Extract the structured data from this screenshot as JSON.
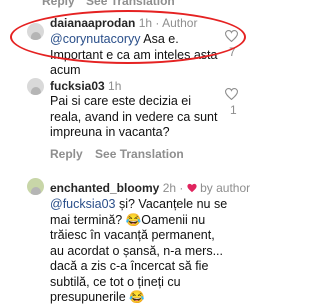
{
  "top_actions": {
    "reply": "Reply",
    "see_translation": "See Translation"
  },
  "comments": [
    {
      "username": "daianaaprodan",
      "time": "1h",
      "author_badge": "Author",
      "mention": "@corynutacoryy",
      "text": " Asa e. Important e ca am inteles asta acum",
      "likes": "7"
    },
    {
      "username": "fucksia03",
      "time": "1h",
      "text": "Pai si care este decizia ei reala, avand in vedere ca sunt impreuna in vacanta?",
      "likes": "1",
      "actions": {
        "reply": "Reply",
        "see_translation": "See Translation"
      }
    },
    {
      "username": "enchanted_bloomy",
      "time": "2h",
      "by_author": "by author",
      "mention": "@fucksia03",
      "text": " și? Vacanțele nu se mai termină? 😂Oamenii nu trăiesc în vacanță permanent, au acordat o șansă, n-a mers... dacă a zis c-a încercat să fie subtilă, ce tot o țineți cu presupunerile 😂"
    }
  ],
  "colors": {
    "highlight": "#e52222",
    "mention": "#2a4f8a",
    "muted": "#8e8e8e",
    "author_heart": "#e0245e"
  }
}
